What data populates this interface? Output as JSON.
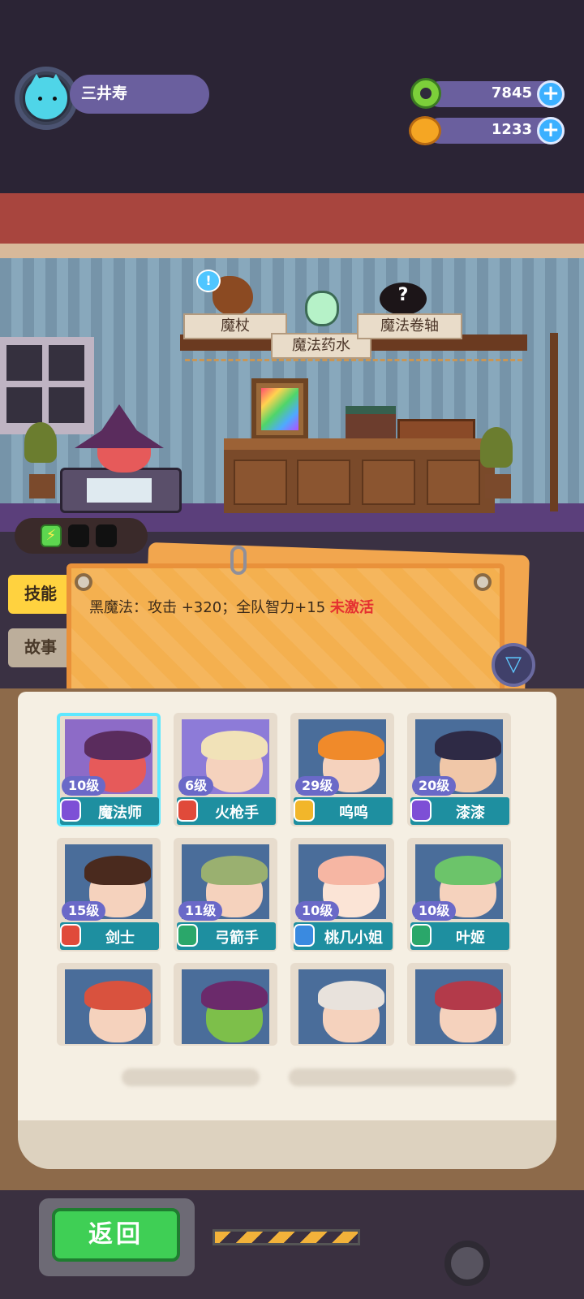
{
  "player": {
    "name": "三井寿",
    "avatar_icon": "cat-icon"
  },
  "currency": [
    {
      "icon": "green-donut-coin-icon",
      "value": "7845"
    },
    {
      "icon": "orange-planet-coin-icon",
      "value": "1233"
    }
  ],
  "items": {
    "staff": "魔杖",
    "potion": "魔法药水",
    "scroll": "魔法卷轴"
  },
  "tabs": {
    "skill": "技能",
    "story": "故事"
  },
  "skill_notice": {
    "prefix": "黑魔法：攻击 +320；全队智力+15",
    "status": "未激活"
  },
  "characters": [
    {
      "level": "10级",
      "name": "魔法师",
      "badge_color": "#7d4fd6",
      "hair": "#5a2c5d",
      "face": "#e65a5a",
      "bg": "#8d6bc7"
    },
    {
      "level": "6级",
      "name": "火枪手",
      "badge_color": "#e04a3a",
      "hair": "#f1e2b8",
      "face": "#f5d2bd",
      "bg": "#8d7bd8"
    },
    {
      "level": "29级",
      "name": "呜呜",
      "badge_color": "#f2b62a",
      "hair": "#f08a2a",
      "face": "#f5d2bd",
      "bg": "#4a6d9a"
    },
    {
      "level": "20级",
      "name": "漆漆",
      "badge_color": "#7d4fd6",
      "hair": "#2e2a45",
      "face": "#f0c7a8",
      "bg": "#4a6d9a"
    },
    {
      "level": "15级",
      "name": "剑士",
      "badge_color": "#e04a3a",
      "hair": "#4a2a1e",
      "face": "#f5d2bd",
      "bg": "#4a6d9a"
    },
    {
      "level": "11级",
      "name": "弓箭手",
      "badge_color": "#2aa76a",
      "hair": "#9ab070",
      "face": "#f5d2bd",
      "bg": "#4a6d9a"
    },
    {
      "level": "10级",
      "name": "桃几小姐",
      "badge_color": "#3a8ae0",
      "hair": "#f6b6a3",
      "face": "#fbe4d6",
      "bg": "#4a6d9a"
    },
    {
      "level": "10级",
      "name": "叶姬",
      "badge_color": "#2aa76a",
      "hair": "#6cc46a",
      "face": "#f5d2bd",
      "bg": "#4a6d9a"
    },
    {
      "level": "",
      "name": "",
      "badge_color": "#e04a3a",
      "hair": "#d9523e",
      "face": "#f5d2bd",
      "bg": "#4a6d9a"
    },
    {
      "level": "",
      "name": "",
      "badge_color": "#7d4fd6",
      "hair": "#6b2a6b",
      "face": "#7dbf4a",
      "bg": "#4a6d9a"
    },
    {
      "level": "",
      "name": "",
      "badge_color": "#2aa76a",
      "hair": "#e8e2dc",
      "face": "#f5d2bd",
      "bg": "#4a6d9a"
    },
    {
      "level": "",
      "name": "",
      "badge_color": "#e04a3a",
      "hair": "#b33a4a",
      "face": "#f5d2bd",
      "bg": "#4a6d9a"
    }
  ],
  "buttons": {
    "back": "返回"
  }
}
